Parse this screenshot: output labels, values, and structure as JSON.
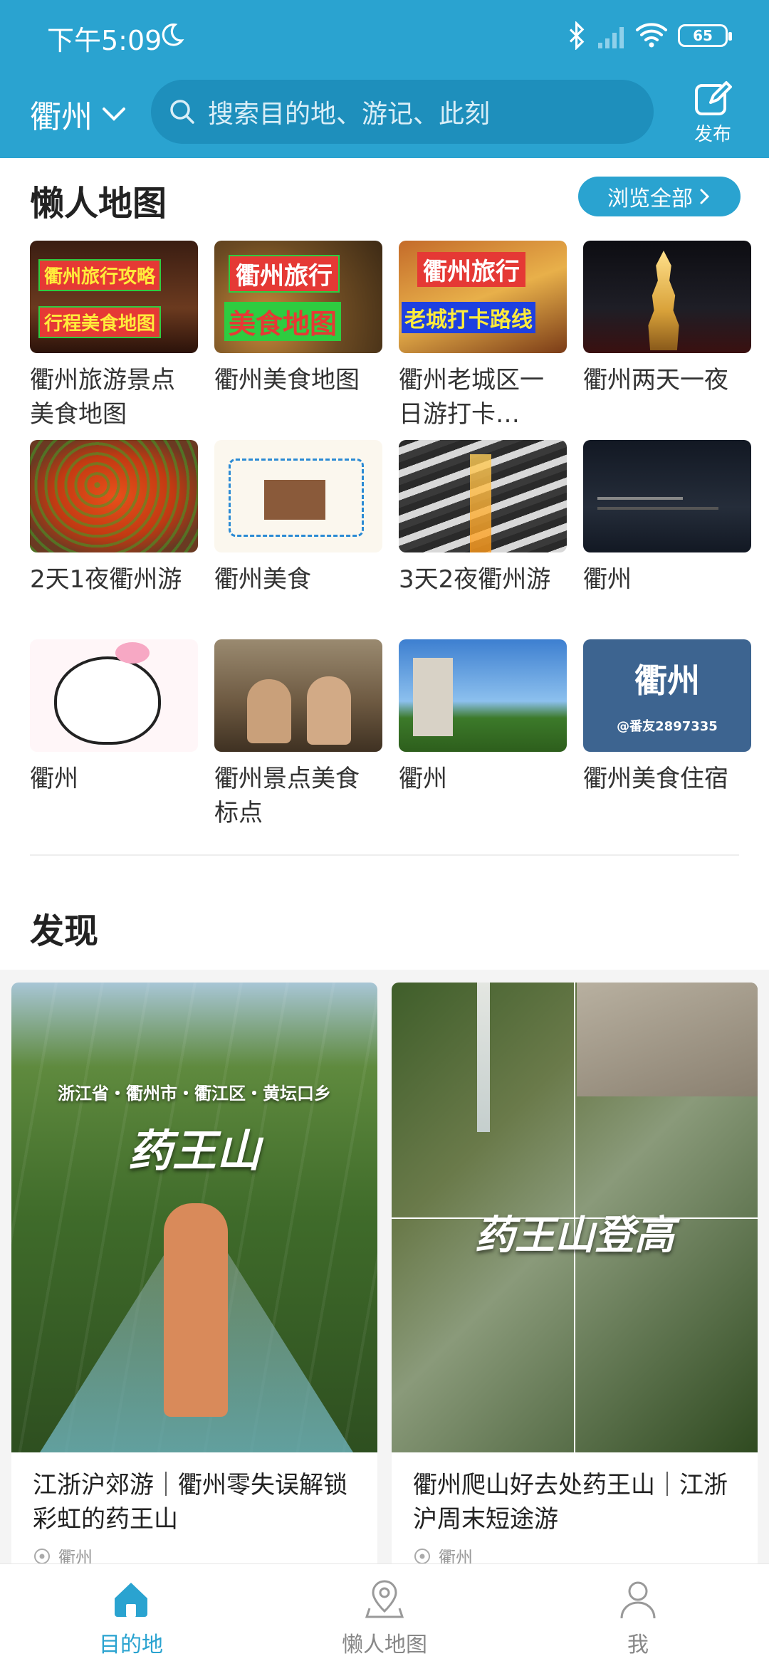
{
  "status_bar": {
    "time": "下午5:09",
    "battery": "65"
  },
  "header": {
    "city": "衢州",
    "search_placeholder": "搜索目的地、游记、此刻",
    "publish_label": "发布"
  },
  "lazy_map": {
    "title": "懒人地图",
    "browse_all": "浏览全部",
    "items": [
      {
        "caption": "衢州旅游景点美食地图",
        "tags": [
          "衢州旅行攻略",
          "行程美食地图"
        ]
      },
      {
        "caption": "衢州美食地图",
        "tags": [
          "衢州旅行",
          "美食地图"
        ]
      },
      {
        "caption": "衢州老城区一日游打卡…",
        "tags": [
          "衢州旅行",
          "老城打卡路线"
        ]
      },
      {
        "caption": "衢州两天一夜",
        "tags": []
      },
      {
        "caption": "2天1夜衢州游",
        "tags": []
      },
      {
        "caption": "衢州美食",
        "tags": []
      },
      {
        "caption": "3天2夜衢州游",
        "tags": []
      },
      {
        "caption": "衢州",
        "tags": []
      },
      {
        "caption": "衢州",
        "tags": []
      },
      {
        "caption": "衢州景点美食标点",
        "tags": []
      },
      {
        "caption": "衢州",
        "tags": []
      },
      {
        "caption": "衢州美食住宿",
        "tags": [
          "衢州",
          "@番友2897335"
        ]
      }
    ]
  },
  "discover": {
    "title": "发现",
    "cards": [
      {
        "image_text": [
          "浙江省・衢州市・衢江区・黄坛口乡",
          "药王山"
        ],
        "title": "江浙沪郊游｜衢州零失误解锁彩虹的药王山",
        "location": "衢州"
      },
      {
        "image_text": [
          "药王山登高"
        ],
        "title": "衢州爬山好去处药王山｜江浙沪周末短途游",
        "location": "衢州"
      }
    ]
  },
  "tabbar": {
    "tabs": [
      {
        "label": "目的地",
        "icon": "home-icon",
        "active": true
      },
      {
        "label": "懒人地图",
        "icon": "map-pin-icon",
        "active": false
      },
      {
        "label": "我",
        "icon": "user-icon",
        "active": false
      }
    ]
  },
  "colors": {
    "accent": "#2aa3d0",
    "header_bg": "#2aa3d0"
  }
}
